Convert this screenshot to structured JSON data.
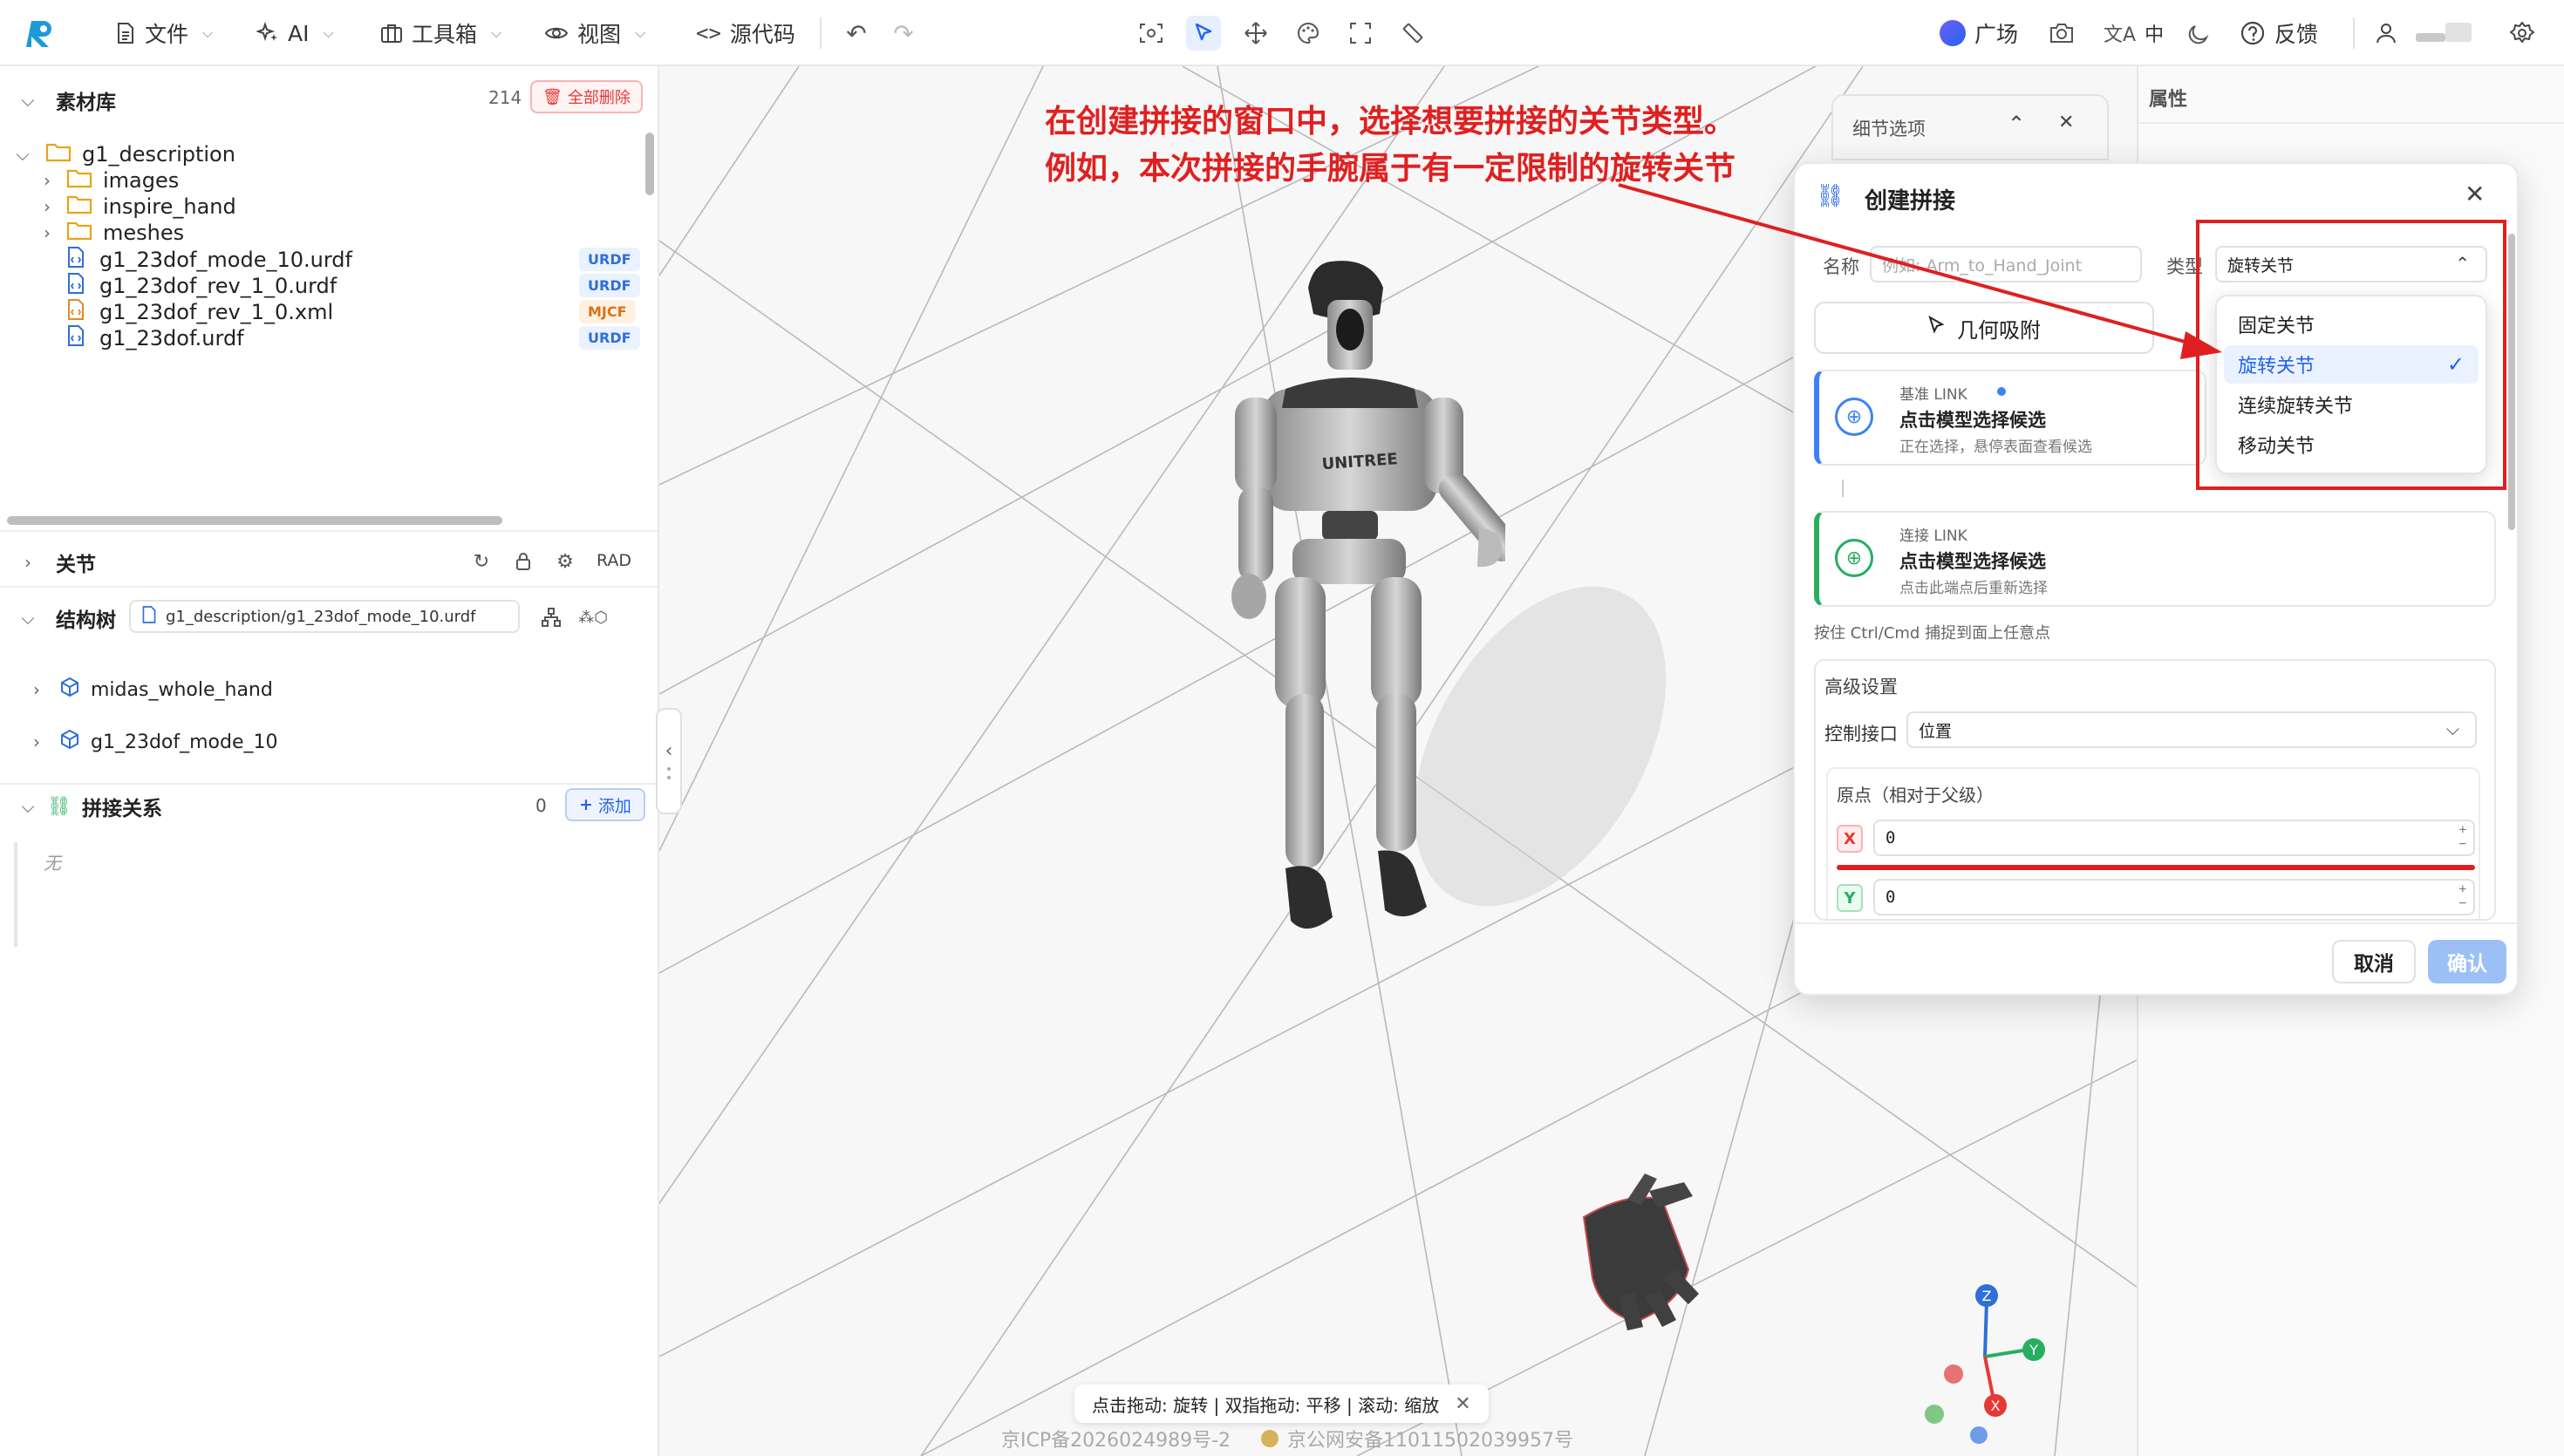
{
  "toolbar": {
    "file": "文件",
    "ai": "AI",
    "toolbox": "工具箱",
    "view": "视图",
    "source": "源代码",
    "plaza": "广场",
    "lang": "中",
    "feedback": "反馈"
  },
  "assets": {
    "title": "素材库",
    "count": "214",
    "delete_all": "全部删除",
    "root": "g1_description",
    "folders": [
      "images",
      "inspire_hand",
      "meshes"
    ],
    "files": [
      {
        "name": "g1_23dof_mode_10.urdf",
        "tag": "URDF"
      },
      {
        "name": "g1_23dof_rev_1_0.urdf",
        "tag": "URDF"
      },
      {
        "name": "g1_23dof_rev_1_0.xml",
        "tag": "MJCF"
      },
      {
        "name": "g1_23dof.urdf",
        "tag": "URDF"
      }
    ]
  },
  "joints": {
    "title": "关节",
    "unit": "RAD"
  },
  "tree": {
    "title": "结构树",
    "path": "g1_description/g1_23dof_mode_10.urdf",
    "items": [
      "midas_whole_hand",
      "g1_23dof_mode_10"
    ]
  },
  "assembly": {
    "title": "拼接关系",
    "count": "0",
    "add": "添加",
    "empty": "无"
  },
  "viewport": {
    "hint": "点击拖动: 旋转 | 双指拖动: 平移 | 滚动: 缩放",
    "icp": "京ICP备2026024989号-2",
    "police": "京公网安备11011502039957号",
    "robot_logo": "UNITREE",
    "axes": {
      "x": "X",
      "y": "Y",
      "z": "Z"
    }
  },
  "detail_panel": {
    "title": "细节选项"
  },
  "props": {
    "title": "属性"
  },
  "annotation": {
    "line1": "在创建拼接的窗口中，选择想要拼接的关节类型。",
    "line2": "例如，本次拼接的手腕属于有一定限制的旋转关节"
  },
  "dialog": {
    "title": "创建拼接",
    "name_label": "名称",
    "name_placeholder": "例如: Arm_to_Hand_Joint",
    "type_label": "类型",
    "type_value": "旋转关节",
    "snap_button": "几何吸附",
    "base_link_label": "基准 LINK",
    "base_link_title": "点击模型选择候选",
    "base_link_sub": "正在选择，悬停表面查看候选",
    "conn_link_label": "连接 LINK",
    "conn_link_title": "点击模型选择候选",
    "conn_link_sub": "点击此端点后重新选择",
    "ctrl_hint": "按住 Ctrl/Cmd 捕捉到面上任意点",
    "advanced": "高级设置",
    "control_label": "控制接口",
    "control_value": "位置",
    "origin_label": "原点（相对于父级）",
    "x_label": "X",
    "x_value": "0",
    "y_label": "Y",
    "y_value": "0",
    "cancel": "取消",
    "confirm": "确认",
    "type_options": [
      "固定关节",
      "旋转关节",
      "连续旋转关节",
      "移动关节"
    ],
    "selected_option": "旋转关节"
  },
  "colors": {
    "accent": "#2563eb",
    "annotation": "#e02020",
    "x_axis": "#e53935",
    "y_axis": "#27ae60",
    "z_axis": "#2f6fd8"
  }
}
